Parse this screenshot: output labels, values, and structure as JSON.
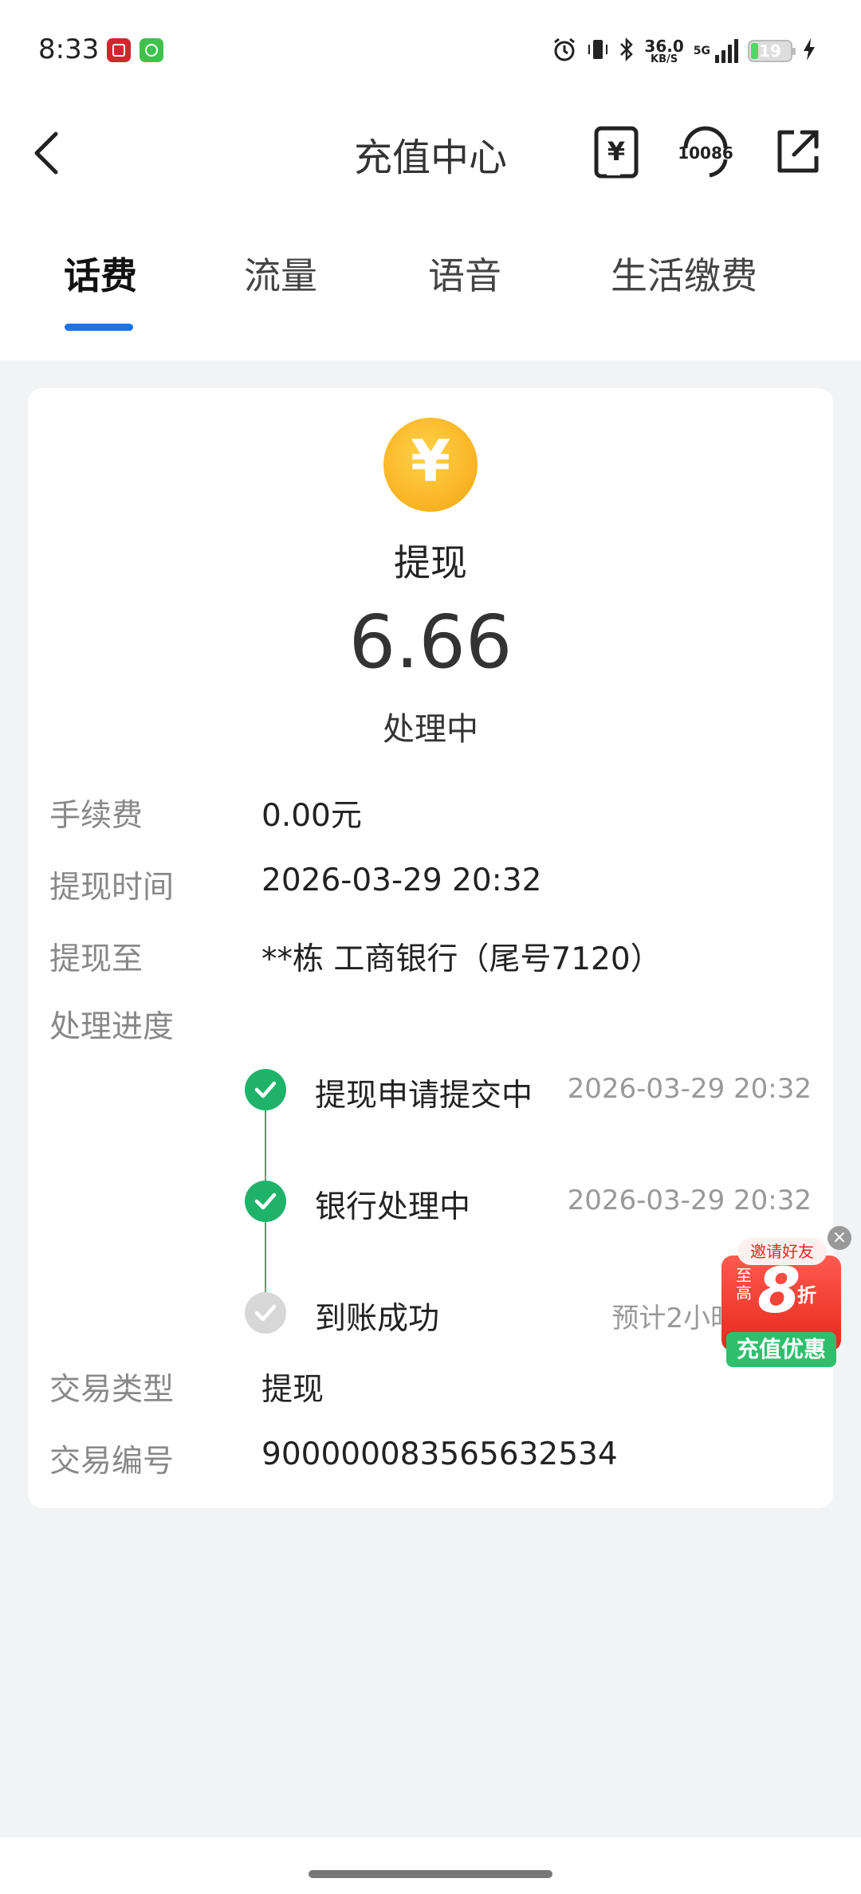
{
  "status_bar": {
    "time": "8:33",
    "speed_value": "36.0",
    "speed_unit": "KB/S",
    "network": "5G",
    "battery": "19",
    "battery_level": 0.19
  },
  "header": {
    "title": "充值中心",
    "service_number": "10086",
    "recharge_icon_glyph": "¥"
  },
  "tabs": [
    {
      "label": "话费",
      "active": true
    },
    {
      "label": "流量",
      "active": false
    },
    {
      "label": "语音",
      "active": false
    },
    {
      "label": "生活缴费",
      "active": false
    }
  ],
  "summary": {
    "coin_glyph": "¥",
    "kind": "提现",
    "amount": "6.66",
    "status": "处理中"
  },
  "details": {
    "fee_label": "手续费",
    "fee_value": "0.00元",
    "time_label": "提现时间",
    "time_value": "2026-03-29 20:32",
    "to_label": "提现至",
    "to_value": "**栋 工商银行（尾号7120）",
    "progress_label": "处理进度",
    "type_label": "交易类型",
    "type_value": "提现",
    "id_label": "交易编号",
    "id_value": "900000083565632534"
  },
  "steps": [
    {
      "label": "提现申请提交中",
      "time": "2026-03-29 20:32",
      "done": true
    },
    {
      "label": "银行处理中",
      "time": "2026-03-29 20:32",
      "done": true
    },
    {
      "label": "到账成功",
      "time": "预计2小时",
      "done": false
    }
  ],
  "promo": {
    "top": "邀请好友",
    "prefix": "至高",
    "number": "8",
    "suffix": "折",
    "bottom": "充值优惠",
    "close": "×"
  },
  "colors": {
    "accent": "#1a73e8",
    "success": "#1fb36a",
    "coin": "#f6a510",
    "background": "#f2f3f5"
  }
}
